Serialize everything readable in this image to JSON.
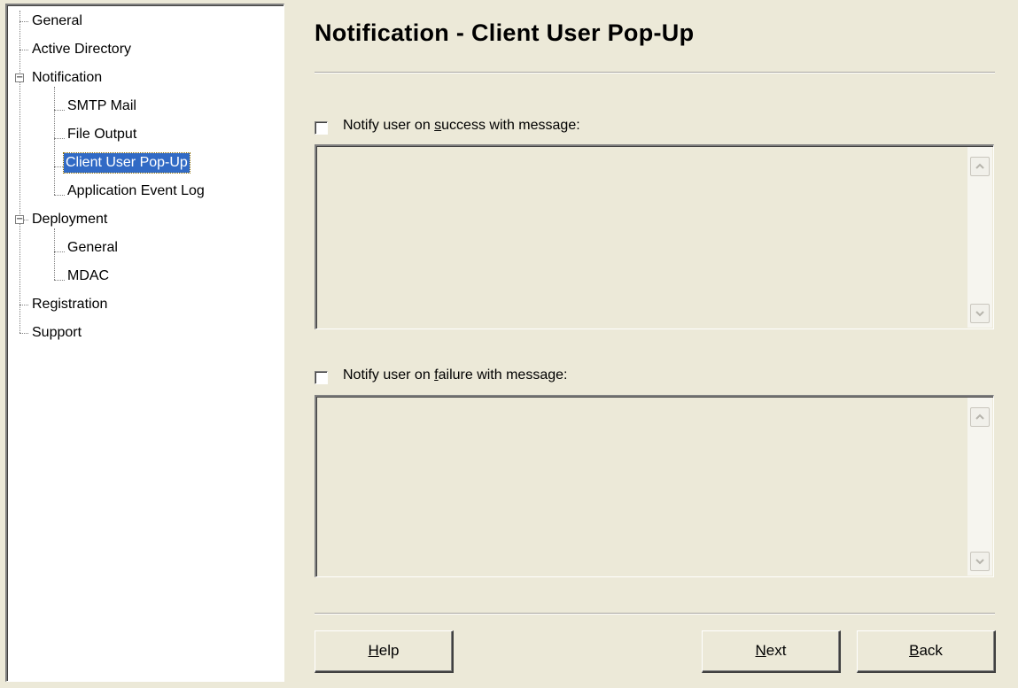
{
  "tree": {
    "items": [
      {
        "label": "General"
      },
      {
        "label": "Active Directory"
      },
      {
        "label": "Notification"
      },
      {
        "label": "SMTP Mail"
      },
      {
        "label": "File Output"
      },
      {
        "label": "Client User Pop-Up"
      },
      {
        "label": "Application Event Log"
      },
      {
        "label": "Deployment"
      },
      {
        "label": "General"
      },
      {
        "label": "MDAC"
      },
      {
        "label": "Registration"
      },
      {
        "label": "Support"
      }
    ],
    "expander_symbol": "−"
  },
  "panel": {
    "title": "Notification - Client User Pop-Up",
    "success": {
      "checked": false,
      "label_pre": "Notify user on ",
      "label_key": "s",
      "label_post": "uccess with message:",
      "message": ""
    },
    "failure": {
      "checked": false,
      "label_pre": "Notify user on ",
      "label_key": "f",
      "label_post": "ailure with message:",
      "message": ""
    }
  },
  "buttons": {
    "help": {
      "key": "H",
      "rest": "elp"
    },
    "next": {
      "key": "N",
      "rest": "ext"
    },
    "back": {
      "key": "B",
      "rest": "ack"
    }
  },
  "colors": {
    "background": "#ece9d8",
    "selection": "#316ac5",
    "tree_background": "#ffffff"
  },
  "icons": {
    "scroll_up": "chevron-up-icon",
    "scroll_down": "chevron-down-icon",
    "collapse": "minus-box-icon"
  }
}
